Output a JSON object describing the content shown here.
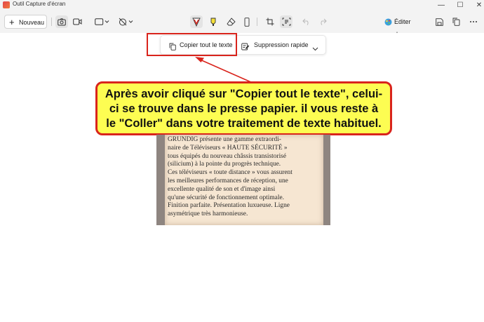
{
  "window": {
    "title": "Outil Capture d'écran",
    "controls": {
      "minimize": "—",
      "maximize": "☐",
      "close": "✕"
    }
  },
  "toolbar": {
    "new_label": "Nouveau",
    "new_plus": "+",
    "edit_label": "Éditer dan...",
    "icons": [
      "camera-icon",
      "video-icon",
      "rectangle-mode-icon",
      "timer-off-icon",
      "ballpoint-pen-icon",
      "highlighter-icon",
      "eraser-icon",
      "ruler-icon",
      "crop-icon",
      "text-actions-icon",
      "undo-icon",
      "redo-icon",
      "paint-icon",
      "save-icon",
      "copy-icon",
      "more-icon"
    ]
  },
  "action_bar": {
    "copy_label": "Copier tout le texte",
    "quick_redact_label": "Suppression rapide"
  },
  "callout": {
    "text": "Après avoir cliqué sur \"Copier tout le texte\", celui-ci se trouve dans le presse papier. il vous reste à le \"Coller\" dans votre traitement de texte habituel."
  },
  "scan": {
    "lines": [
      "GRUNDIG présente une gamme extraordi-",
      "naire de Téléviseurs « HAUTE SÉCURITÉ »",
      "tous équipés du nouveau châssis transistorisé",
      "(silicium) à la pointe du progrès technique.",
      "Ces téléviseurs « toute distance » vous assurent",
      "les meilleures performances de réception, une",
      "excellente qualité de son et d'image ainsi",
      "qu'une sécurité de fonctionnement optimale.",
      "Finition parfaite. Présentation luxueuse. Ligne",
      "asymétrique très harmonieuse."
    ]
  },
  "colors": {
    "accent_red": "#d9241c",
    "callout_yellow": "#fdfd52",
    "chrome": "#f3f3f3"
  }
}
